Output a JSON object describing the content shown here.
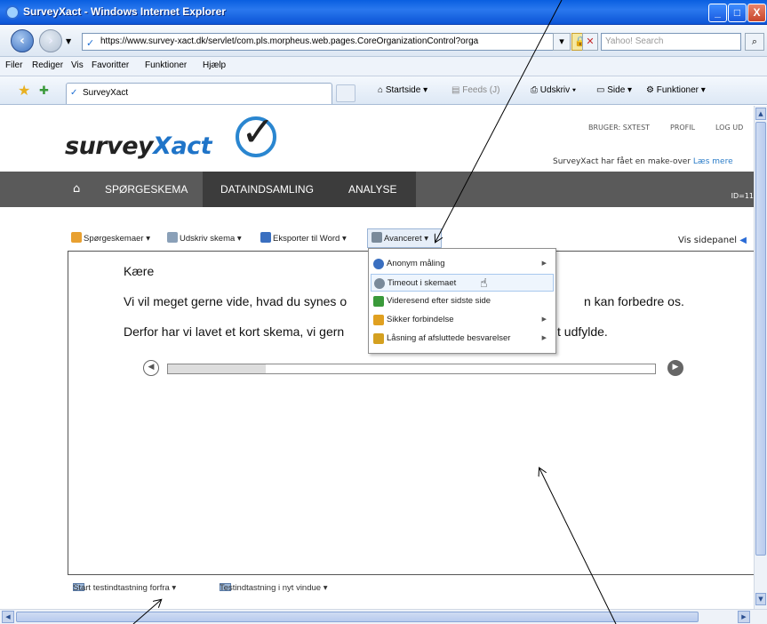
{
  "window": {
    "title": "SurveyXact - Windows Internet Explorer",
    "min": "_",
    "max": "□",
    "close": "X"
  },
  "browser": {
    "url": "https://www.survey-xact.dk/servlet/com.pls.morpheus.web.pages.CoreOrganizationControl?orga",
    "search_placeholder": "Yahoo! Search",
    "menu": [
      "Filer",
      "Rediger",
      "Vis",
      "Favoritter",
      "Funktioner",
      "Hjælp"
    ],
    "tab_title": "SurveyXact",
    "commands": {
      "home": "Startside",
      "feeds": "Feeds (J)",
      "print": "Udskriv",
      "page": "Side",
      "tools": "Funktioner"
    }
  },
  "site": {
    "top_links": [
      "BRUGER: SXTEST",
      "PROFIL",
      "LOG UD"
    ],
    "logo_prefix": "survey",
    "logo_accent": "Xact",
    "makeover_text": "SurveyXact har fået en make-over",
    "makeover_link": "Læs mere",
    "nav": [
      "SPØRGESKEMA",
      "DATAINDSAMLING",
      "ANALYSE"
    ],
    "nav_id": "ID=11"
  },
  "toolbar": {
    "items": [
      "Spørgeskemaer ▾",
      "Udskriv skema ▾",
      "Eksporter til Word ▾",
      "Avanceret ▾"
    ],
    "side_panel": "Vis sidepanel"
  },
  "dropdown": {
    "items": [
      {
        "label": "Anonym måling",
        "submenu": true,
        "color": "#3a6fc0"
      },
      {
        "label": "Timeout i skemaet",
        "submenu": false,
        "color": "#7a8a9a"
      },
      {
        "label": "Videresend efter sidste side",
        "submenu": false,
        "color": "#3a9a3a"
      },
      {
        "label": "Sikker forbindelse",
        "submenu": true,
        "color": "#e0a020"
      },
      {
        "label": "Låsning af afsluttede besvarelser",
        "submenu": true,
        "color": "#d4a020"
      }
    ],
    "highlighted_index": 1
  },
  "survey": {
    "greeting": "Kære",
    "line1_a": "Vi vil meget gerne vide, hvad du synes o",
    "line1_b": "n kan forbedre os.",
    "line2_a": "Derfor har vi lavet et kort skema, vi gern",
    "line2_b": "t udfylde.",
    "progress": 0.2
  },
  "bottom_toolbar": {
    "start_test": "Start testindtastning forfra ▾",
    "new_window": "Testindtastning i nyt vindue ▾"
  }
}
